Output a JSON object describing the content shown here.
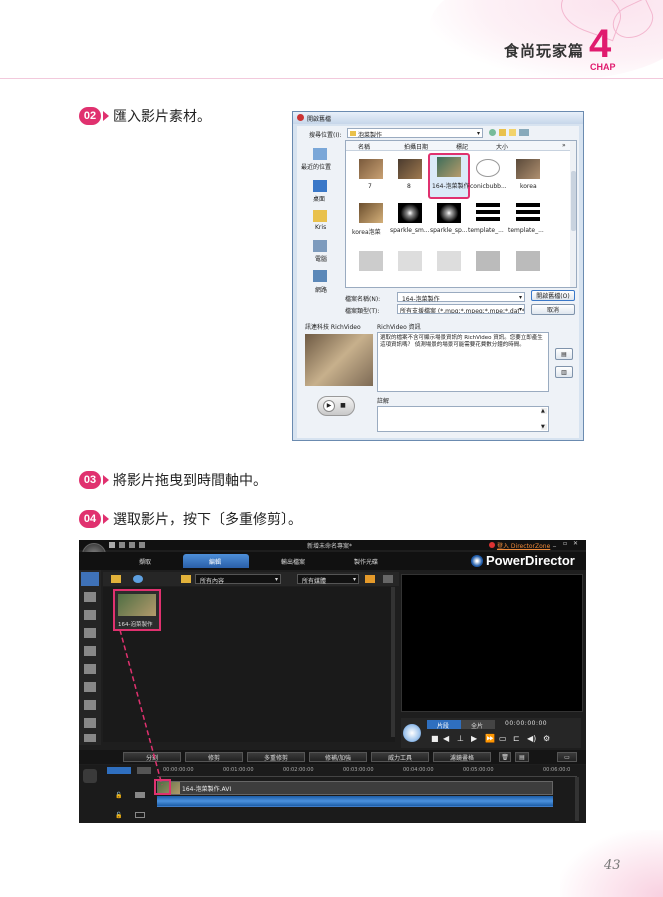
{
  "header": {
    "title": "食尚玩家篇",
    "chapter_number": "4",
    "chapter_label": "CHAP"
  },
  "steps": [
    {
      "badge": "02",
      "text": "匯入影片素材。"
    },
    {
      "badge": "03",
      "text": "將影片拖曳到時間軸中。"
    },
    {
      "badge": "04",
      "text": "選取影片，按下〔多重修剪〕。"
    }
  ],
  "open_dialog": {
    "title": "開啟舊檔",
    "look_in_label": "搜尋位置(I):",
    "look_in_value": "泡菜製作",
    "columns": [
      "名稱",
      "拍攝日期",
      "標記",
      "大小"
    ],
    "places": [
      "最近的位置",
      "桌面",
      "Kris",
      "電腦",
      "網路"
    ],
    "files": [
      "7",
      "8",
      "164-泡菜製作",
      "conicbubb...",
      "korea",
      "korea泡菜",
      "sparkle_sm...",
      "sparkle_sp...",
      "template_...",
      "template_..."
    ],
    "filename_label": "檔案名稱(N):",
    "filename_value": "164-泡菜製作",
    "filetype_label": "檔案類型(T):",
    "filetype_value": "所有支援檔案 (*.mpg;*.mpeg;*.mpe;*.dat;*.a",
    "open_button": "開啟舊檔(O)",
    "cancel_button": "取消",
    "preview_label": "訊連科技 RichVideo",
    "info_label": "RichVideo 資訊",
    "info_text": "選取的檔案不含可顯示場景資訊的 RichVideo 資訊。您要立即產生這項資訊嗎？ 偵測場景的場景可能需要花費數分鐘的時間。",
    "comment_label": "註解"
  },
  "powerdirector": {
    "window_title": "新增未命名專案*",
    "tabs": [
      "擷取",
      "編輯",
      "輸出檔案",
      "製作光碟"
    ],
    "login_link": "登入 DirectorZone",
    "brand": "PowerDirector",
    "filter_content": "所有內容",
    "filter_media": "所有媒體",
    "clip_label": "164-泡菜製作",
    "preview_toggle": [
      "片段",
      "全片"
    ],
    "timecode": "00:00:00:00",
    "edit_buttons": [
      "分割",
      "修剪",
      "多重修剪",
      "修補/加強",
      "威力工具",
      "濾鏡畫格"
    ],
    "ruler_marks": [
      "00:00:00:00",
      "00:01:00:00",
      "00:02:00:00",
      "00:03:00:00",
      "00:04:00:00",
      "00:05:00:00",
      "00:06:00:0"
    ],
    "timeline_clip": "164-泡菜製作.AVI"
  },
  "page_number": "43",
  "colors": {
    "accent": "#e0316f",
    "pd_blue": "#2f6fbf"
  }
}
